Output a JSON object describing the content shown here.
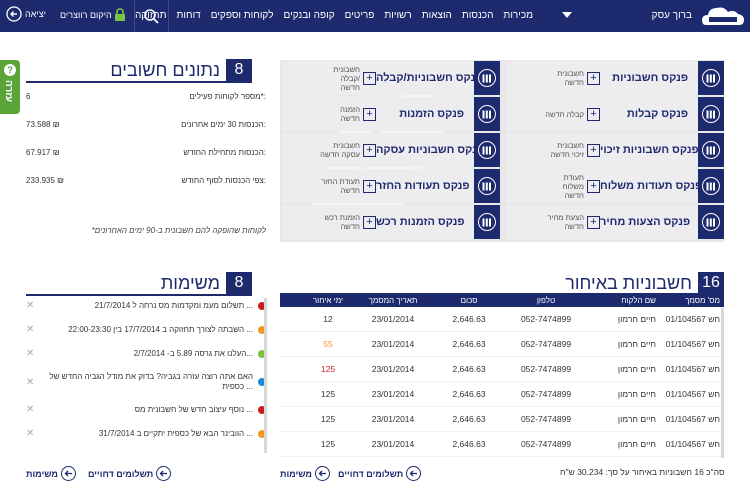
{
  "header": {
    "business_name": "ברוך עסק",
    "menu": [
      "מכירות",
      "הכנסות",
      "הוצאות",
      "רשויות",
      "פריטים",
      "קופה ובנקים",
      "לקוחות וספקים",
      "דוחות",
      "תחזוקה"
    ],
    "license_label": "היקום רווצרים",
    "exit_label": "יציאה"
  },
  "help": {
    "label": "עזרה"
  },
  "key_figures": {
    "count": "8",
    "title": "נתונים חשובים",
    "rows": [
      {
        "label": "מספר לקוחות פעילים*:",
        "value": "6"
      },
      {
        "label": "הכנסות 30 ימים אחרונים:",
        "value": "73.588 ₪"
      },
      {
        "label": "הכנסות מתחילת החודש:",
        "value": "67.917 ₪"
      },
      {
        "label": "צפי הכנסות לסוף החודש:",
        "value": "233.935 ₪"
      }
    ],
    "note": "*לקוחות שהופקה להם חשבונית ב-90 ימים האחרונים"
  },
  "ledgers": {
    "right": [
      {
        "name": "פנקס חשבוניות",
        "new": "חשבונית חדשה"
      },
      {
        "name": "פנקס קבלות",
        "new": "קבלה חדשה"
      },
      {
        "name": "פנקס חשבוניות זיכוי",
        "new": "חשבונית זיכוי חדשה"
      },
      {
        "name": "פנקס תעודות משלוח",
        "new": "תעודת משלוח חדשה"
      },
      {
        "name": "פנקס הצעות מחיר",
        "new": "הצעת מחיר חדשה"
      }
    ],
    "left": [
      {
        "name": "פנקס חשבוניות/קבלה",
        "new": "חשבונית /קבלה חדשה"
      },
      {
        "name": "פנקס הזמנות",
        "new": "הזמנה חדשה"
      },
      {
        "name": "פנקס חשבוניות עסקה",
        "new": "חשבונית עסקה חדשה"
      },
      {
        "name": "פנקס תעודות החזר",
        "new": "תעודת החזר חדשה"
      },
      {
        "name": "פנקס הזמנות רכש",
        "new": "הזמנת רכש חדשה"
      }
    ]
  },
  "invoices": {
    "count": "16",
    "title": "חשבוניות באיחור",
    "columns": [
      "מס' מסמך",
      "שם הלקוח",
      "טלפון",
      "סכום",
      "תאריך המסמך",
      "ימי איחור"
    ],
    "rows": [
      {
        "doc": "01/104567 חש",
        "customer": "חיים חרמון",
        "phone": "052-7474899",
        "amount": "2,646.63",
        "date": "23/01/2014",
        "days": "12",
        "color": "#333333"
      },
      {
        "doc": "01/104567 חש",
        "customer": "חיים חרמון",
        "phone": "052-7474899",
        "amount": "2,646.63",
        "date": "23/01/2014",
        "days": "55",
        "color": "#f29a1c"
      },
      {
        "doc": "01/104567 חש",
        "customer": "חיים חרמון",
        "phone": "052-7474899",
        "amount": "2,646.63",
        "date": "23/01/2014",
        "days": "125",
        "color": "#d02020"
      },
      {
        "doc": "01/104567 חש",
        "customer": "חיים חרמון",
        "phone": "052-7474899",
        "amount": "2,646.63",
        "date": "23/01/2014",
        "days": "125",
        "color": "#333333"
      },
      {
        "doc": "01/104567 חש",
        "customer": "חיים חרמון",
        "phone": "052-7474899",
        "amount": "2,646.63",
        "date": "23/01/2014",
        "days": "125",
        "color": "#333333"
      },
      {
        "doc": "01/104567 חש",
        "customer": "חיים חרמון",
        "phone": "052-7474899",
        "amount": "2,646.63",
        "date": "23/01/2014",
        "days": "125",
        "color": "#333333"
      }
    ],
    "total": "סה\"כ 16 חשבוניות באיחור על סך: 30.234 ש\"ח",
    "link_payments": "תשלומים דחויים",
    "link_tasks": "משימות"
  },
  "tasks": {
    "count": "8",
    "title": "משימות",
    "items": [
      {
        "text": "תשלום מעמ ומקדמות מס נרחה ל 21/7/2014 ...",
        "color": "#d01c1c"
      },
      {
        "text": "השבתה לצורך תחזוקה ב 17/7/2014 בין 22:00-23:30 ...",
        "color": "#f29a1c"
      },
      {
        "text": "העלנו את גרסה 5.89 ב- 2/7/2014...",
        "color": "#7cc242"
      },
      {
        "text": "האם אתה רוצה עזרה בגביה? בדוק את מודל הגביה החדש של כספית ...",
        "color": "#1e88d8"
      },
      {
        "text": "נוסף עיצוב חדש של חשבונית מס ...",
        "color": "#d01c1c"
      },
      {
        "text": "הוובינר הבא של כספית יתקיים ב 31/7/2014 ...",
        "color": "#f29a1c"
      }
    ],
    "link_payments": "תשלומים דחויים",
    "link_tasks": "משימות"
  }
}
